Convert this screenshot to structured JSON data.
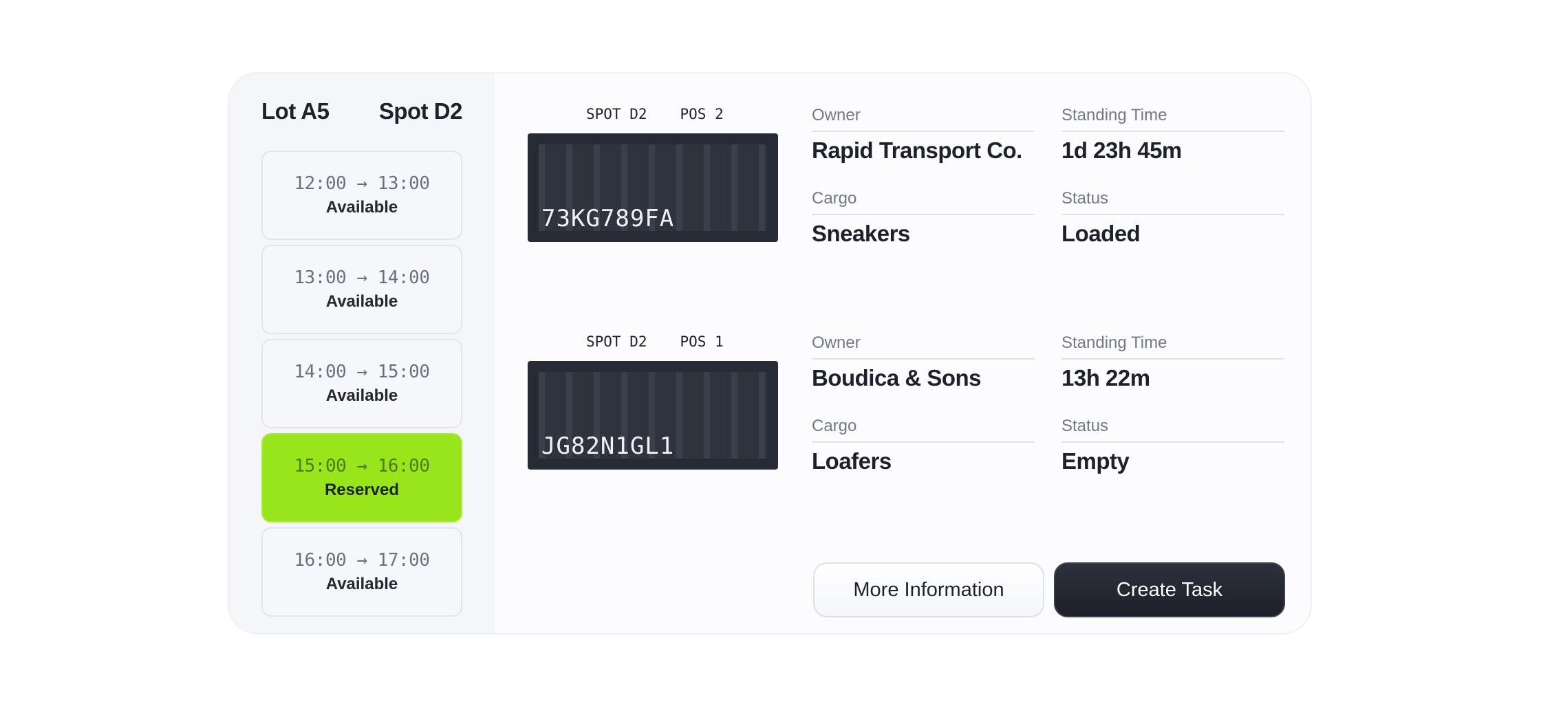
{
  "header": {
    "lot": "Lot A5",
    "spot": "Spot D2"
  },
  "slots": [
    {
      "time": "12:00 → 13:00",
      "state": "Available"
    },
    {
      "time": "13:00 → 14:00",
      "state": "Available"
    },
    {
      "time": "14:00 → 15:00",
      "state": "Available"
    },
    {
      "time": "15:00 → 16:00",
      "state": "Reserved"
    },
    {
      "time": "16:00 → 17:00",
      "state": "Available"
    }
  ],
  "containers": [
    {
      "spot": "SPOT D2",
      "pos": "POS 2",
      "plate": "73KG789FA",
      "owner_label": "Owner",
      "owner": "Rapid Transport Co.",
      "standing_label": "Standing Time",
      "standing": "1d 23h 45m",
      "cargo_label": "Cargo",
      "cargo": "Sneakers",
      "status_label": "Status",
      "status": "Loaded"
    },
    {
      "spot": "SPOT D2",
      "pos": "POS 1",
      "plate": "JG82N1GL1",
      "owner_label": "Owner",
      "owner": "Boudica & Sons",
      "standing_label": "Standing Time",
      "standing": "13h 22m",
      "cargo_label": "Cargo",
      "cargo": "Loafers",
      "status_label": "Status",
      "status": "Empty"
    }
  ],
  "actions": {
    "more_info": "More Information",
    "create_task": "Create Task"
  },
  "colors": {
    "reserved": "#99e51c",
    "container": "#272b35",
    "primary_button": "#1d2029"
  }
}
